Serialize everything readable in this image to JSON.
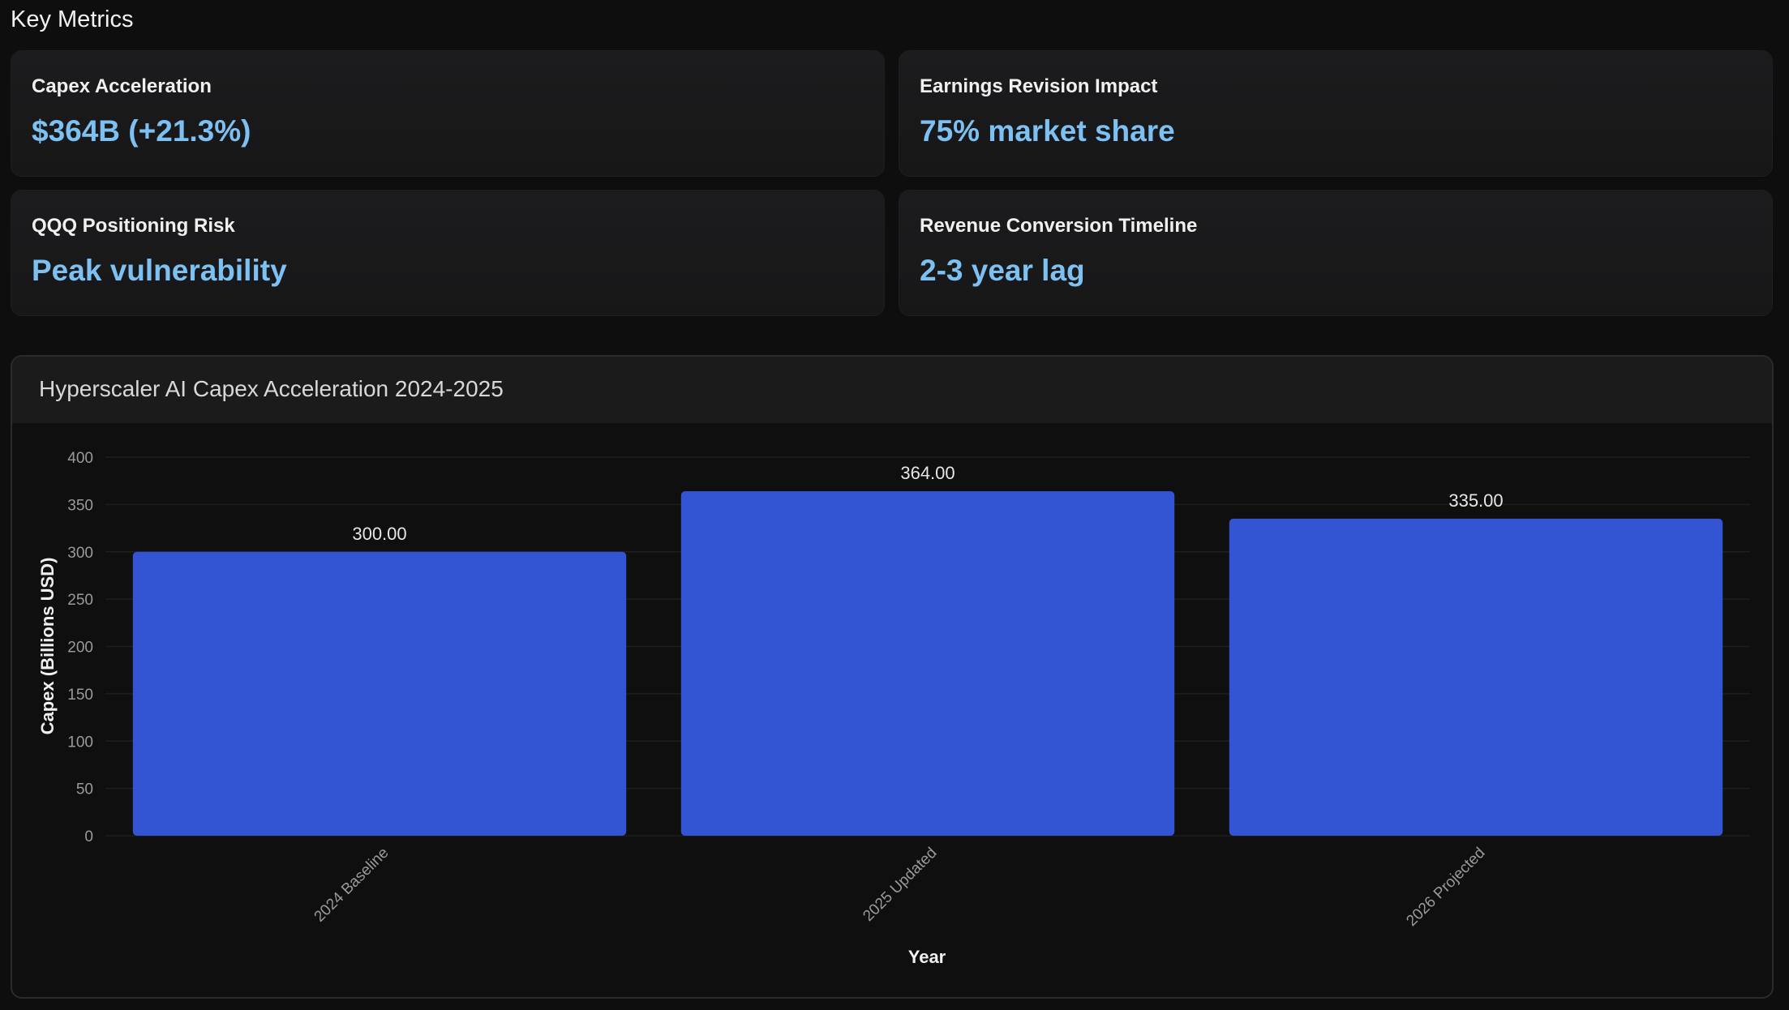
{
  "page": {
    "section_title": "Key Metrics"
  },
  "metrics": [
    {
      "label": "Capex Acceleration",
      "value": "$364B (+21.3%)"
    },
    {
      "label": "Earnings Revision Impact",
      "value": "75% market share"
    },
    {
      "label": "QQQ Positioning Risk",
      "value": "Peak vulnerability"
    },
    {
      "label": "Revenue Conversion Timeline",
      "value": "2-3 year lag"
    }
  ],
  "colors": {
    "accent_value": "#7dc0f2",
    "bar": "#3355d4",
    "background": "#0e0e0e"
  },
  "chart_data": {
    "type": "bar",
    "title": "Hyperscaler AI Capex Acceleration 2024-2025",
    "categories": [
      "2024 Baseline",
      "2025 Updated",
      "2026 Projected"
    ],
    "values": [
      300,
      364,
      335
    ],
    "value_labels": [
      "300.00",
      "364.00",
      "335.00"
    ],
    "xlabel": "Year",
    "ylabel": "Capex (Billions USD)",
    "ylim": [
      0,
      400
    ],
    "yticks": [
      0,
      50,
      100,
      150,
      200,
      250,
      300,
      350,
      400
    ],
    "grid": true,
    "legend": "none"
  }
}
